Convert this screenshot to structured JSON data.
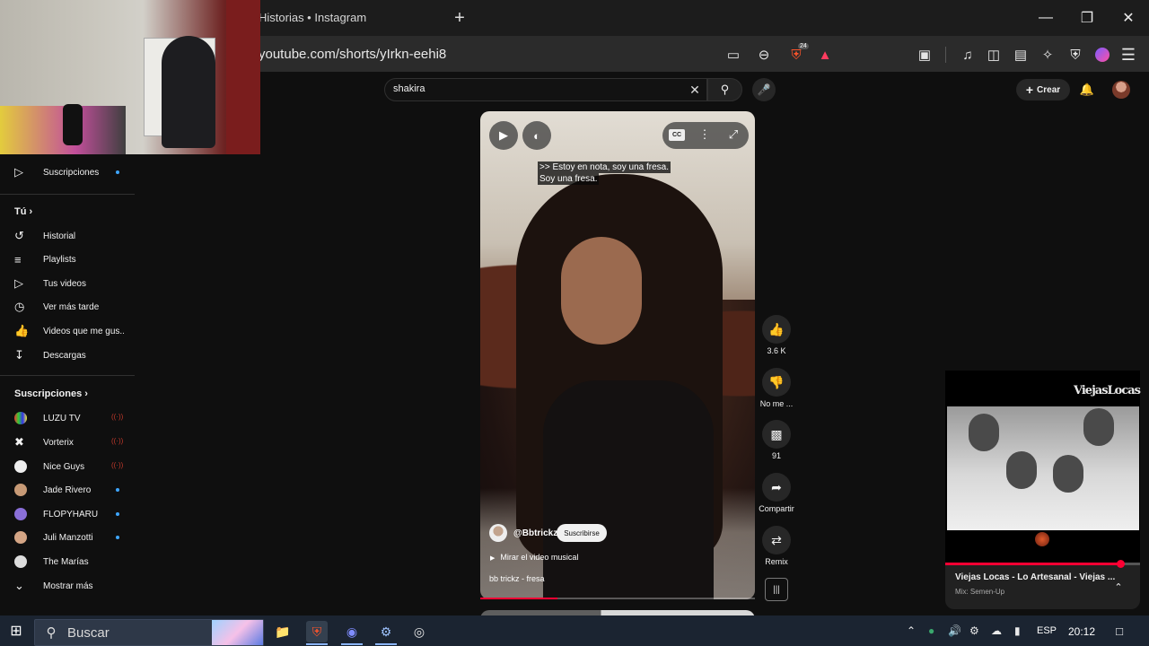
{
  "browser": {
    "tab_title": "Historias • Instagram",
    "new_tab_icon": "+",
    "url": "youtube.com/shorts/yIrkn-eehi8",
    "shield_badge": "24"
  },
  "youtube": {
    "search_value": "shakira",
    "create_label": "Crear"
  },
  "sidebar": {
    "subs_item": "Suscripciones",
    "you_header": "Tú",
    "you_items": [
      {
        "label": "Historial",
        "icon": "history-icon"
      },
      {
        "label": "Playlists",
        "icon": "playlists-icon"
      },
      {
        "label": "Tus videos",
        "icon": "your-videos-icon"
      },
      {
        "label": "Ver más tarde",
        "icon": "watch-later-icon"
      },
      {
        "label": "Videos que me gus...",
        "icon": "liked-icon"
      },
      {
        "label": "Descargas",
        "icon": "downloads-icon"
      }
    ],
    "subs_header": "Suscripciones",
    "channels": [
      {
        "label": "LUZU TV",
        "status": "live"
      },
      {
        "label": "Vorterix",
        "status": "live"
      },
      {
        "label": "Nice Guys",
        "status": "live"
      },
      {
        "label": "Jade Rivero",
        "status": "new"
      },
      {
        "label": "FLOPYHARU",
        "status": "new"
      },
      {
        "label": "Juli Manzotti",
        "status": "new"
      },
      {
        "label": "The Marías",
        "status": ""
      }
    ],
    "show_more": "Mostrar más",
    "live_glyph": "((·))"
  },
  "short": {
    "caption_line1": ">> Estoy en nota, soy una fresa.",
    "caption_line2": "Soy una fresa.",
    "channel": "@Bbtrickz",
    "subscribe": "Suscribirse",
    "music_link": "Mirar el video musical",
    "title": "bb trickz - fresa",
    "cc_label": "CC",
    "progress": 0.28,
    "likes": "3.6 K",
    "dislike_label": "No me ...",
    "comments": "91",
    "share_label": "Compartir",
    "remix_label": "Remix"
  },
  "mini_player": {
    "logo": "ViejasLocas",
    "title": "Viejas Locas - Lo Artesanal - Viejas ...",
    "subtitle": "Mix: Semen-Up",
    "progress": 0.9
  },
  "taskbar": {
    "search_placeholder": "Buscar",
    "lang": "ESP",
    "time": "20:12"
  },
  "colors": {
    "accent_red": "#ff0033",
    "link_blue": "#3ea6ff",
    "taskbar": "#1b2431"
  }
}
